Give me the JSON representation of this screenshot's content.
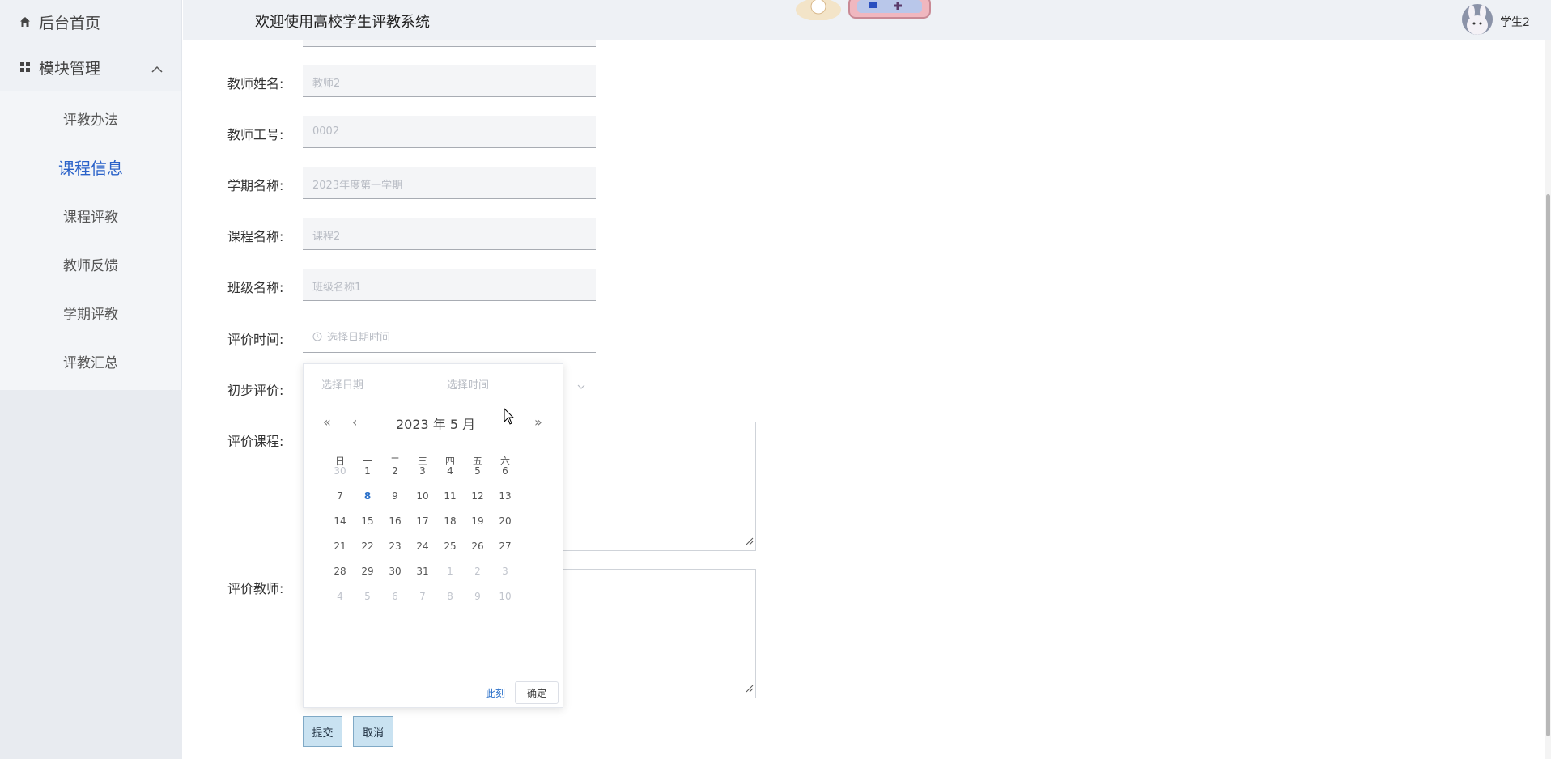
{
  "header": {
    "title": "欢迎使用高校学生评教系统",
    "user_name": "学生2"
  },
  "sidebar": {
    "home_label": "后台首页",
    "group_label": "模块管理",
    "items": [
      {
        "label": "评教办法"
      },
      {
        "label": "课程信息"
      },
      {
        "label": "课程评教"
      },
      {
        "label": "教师反馈"
      },
      {
        "label": "学期评教"
      },
      {
        "label": "评教汇总"
      }
    ]
  },
  "form": {
    "teacher_name": {
      "label": "教师姓名:",
      "value": "教师2"
    },
    "teacher_id": {
      "label": "教师工号:",
      "value": "0002"
    },
    "term_name": {
      "label": "学期名称:",
      "value": "2023年度第一学期"
    },
    "course_name": {
      "label": "课程名称:",
      "value": "课程2"
    },
    "class_name": {
      "label": "班级名称:",
      "value": "班级名称1"
    },
    "eval_time": {
      "label": "评价时间:",
      "placeholder": "选择日期时间"
    },
    "initial_eval": {
      "label": "初步评价:"
    },
    "eval_course": {
      "label": "评价课程:"
    },
    "eval_teacher": {
      "label": "评价教师:"
    },
    "submit_label": "提交",
    "cancel_label": "取消"
  },
  "picker": {
    "date_placeholder": "选择日期",
    "time_placeholder": "选择时间",
    "month_label": "2023 年  5 月",
    "weekdays": [
      "日",
      "一",
      "二",
      "三",
      "四",
      "五",
      "六"
    ],
    "weeks": [
      [
        "30",
        "1",
        "2",
        "3",
        "4",
        "5",
        "6"
      ],
      [
        "7",
        "8",
        "9",
        "10",
        "11",
        "12",
        "13"
      ],
      [
        "14",
        "15",
        "16",
        "17",
        "18",
        "19",
        "20"
      ],
      [
        "21",
        "22",
        "23",
        "24",
        "25",
        "26",
        "27"
      ],
      [
        "28",
        "29",
        "30",
        "31",
        "1",
        "2",
        "3"
      ],
      [
        "4",
        "5",
        "6",
        "7",
        "8",
        "9",
        "10"
      ]
    ],
    "dim_cells": [
      [
        0,
        0
      ],
      [
        4,
        4
      ],
      [
        4,
        5
      ],
      [
        4,
        6
      ],
      [
        5,
        0
      ],
      [
        5,
        1
      ],
      [
        5,
        2
      ],
      [
        5,
        3
      ],
      [
        5,
        4
      ],
      [
        5,
        5
      ],
      [
        5,
        6
      ]
    ],
    "today_cell": [
      1,
      1
    ],
    "now_label": "此刻",
    "confirm_label": "确定"
  },
  "colors": {
    "accent": "#2a62c9",
    "sidebar_bg": "#eef1f5",
    "button_bg": "#c9e2f1"
  }
}
